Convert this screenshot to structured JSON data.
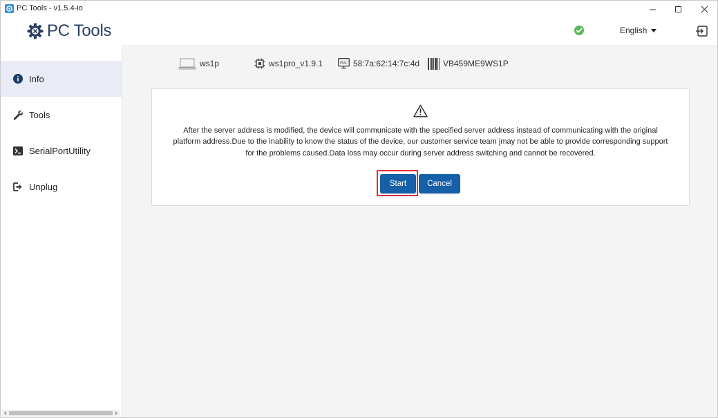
{
  "window": {
    "title": "PC Tools - v1.5.4-io",
    "controls": {
      "minimize": "—",
      "maximize": "☐",
      "close": "✕"
    }
  },
  "header": {
    "logo_text": "PC Tools",
    "status_icon": "check-circle-icon",
    "language": "English"
  },
  "sidebar": {
    "items": [
      {
        "label": "Info",
        "icon": "info-icon",
        "active": true
      },
      {
        "label": "Tools",
        "icon": "wrench-icon",
        "active": false
      },
      {
        "label": "SerialPortUtility",
        "icon": "terminal-icon",
        "active": false
      },
      {
        "label": "Unplug",
        "icon": "unplug-icon",
        "active": false
      }
    ]
  },
  "device": {
    "model": "ws1p",
    "firmware": "ws1pro_v1.9.1",
    "mac_badge": "MAC",
    "mac": "58:7a:62:14:7c:4d",
    "serial": "VB459ME9WS1P"
  },
  "dialog": {
    "message": "After the server address is modified, the device will communicate with the specified server address instead of communicating with the original platform address.Due to the inability to know the status of the device, our customer service team jmay not be able to provide corresponding support for the problems caused.Data loss may occur during server address switching and cannot be recovered.",
    "start_label": "Start",
    "cancel_label": "Cancel"
  },
  "colors": {
    "primary": "#1560a8",
    "highlight": "#e0303a",
    "active_bg": "#e9ecf6",
    "success": "#5cb85c",
    "logo": "#2b3f63"
  }
}
